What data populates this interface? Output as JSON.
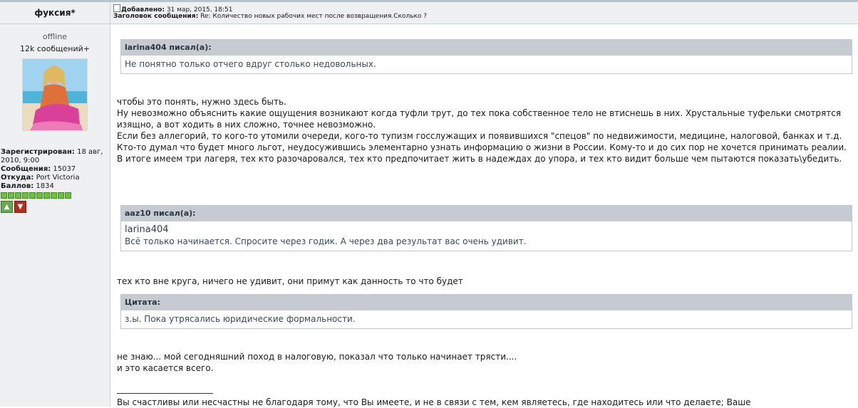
{
  "author": {
    "name": "фуксия*",
    "status": "offline",
    "post_count": "12k сообщений+",
    "registered_label": "Зарегистрирован:",
    "registered_value": "18 авг, 2010, 9:00",
    "posts_label": "Сообщения:",
    "posts_value": "15037",
    "from_label": "Откуда:",
    "from_value": "Port Victoria",
    "points_label": "Баллов:",
    "points_value": "1834",
    "rep_level": 10
  },
  "post": {
    "added_label": "Добавлено:",
    "added_value": "31 мар, 2015, 18:51",
    "subject_label": "Заголовок сообщения:",
    "subject_value": "Re: Количество новых рабочих мест после возвращения.Сколько ?"
  },
  "quote1": {
    "header": "larina404 писал(а):",
    "text": "Не понятно только отчего вдруг столько недовольных."
  },
  "para1": [
    "чтобы это понять, нужно здесь быть.",
    "Ну невозможно объяснить какие ощущения возникают когда туфли трут, до тех пока собственное тело не втиснешь в них. Хрустальные туфельки смотрятся изящно, а вот ходить в них сложно, точнее невозможно.",
    "Если без аллегорий, то кого-то утомили очереди, кого-то тупизм госслужащих и появившихся \"спецов\" по недвижимости, медицине, налоговой, банках и т.д.",
    "Кто-то думал что будет много льгот, неудосужившись элементарно узнать информацию о жизни в России. Кому-то и до сих пор не хочется принимать реалии. В итоге имеем три лагеря, тех кто разочаровался, тех кто предпочитает жить в надеждах до упора, и тех кто видит больше чем пытаются показать\\убедить."
  ],
  "quote2": {
    "header": "aaz10 писал(а):",
    "name": "larina404",
    "text": "Всё только начинается. Спросите через годик. А через два результат вас очень удивит."
  },
  "para2": "тех кто вне круга, ничего не удивит, они примут как данность то что будет",
  "quote3": {
    "header": "Цитата:",
    "text": "з.ы. Пока утрясались юридические формальности."
  },
  "para3": [
    "не знаю... мой сегодняшний поход в налоговую, показал что только начинает трясти....",
    "и это касается всего."
  ],
  "signature": "Вы счастливы или несчастны не благодаря тому, что Вы имеете, и не в связи с тем, кем являетесь, где находитесь или что делаете; Ваше"
}
